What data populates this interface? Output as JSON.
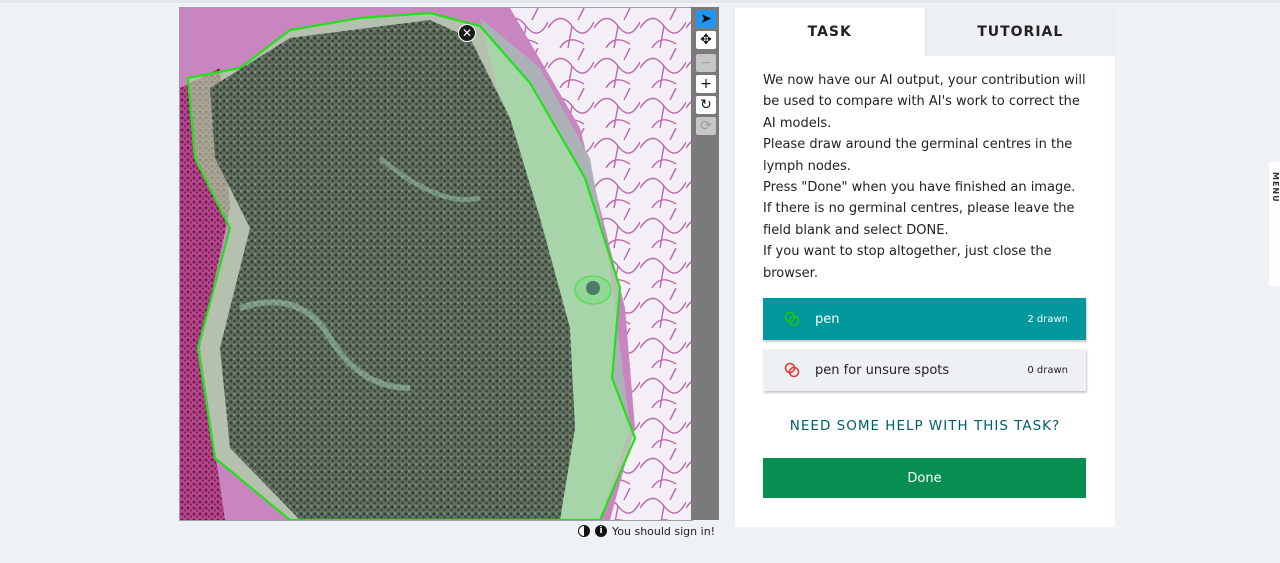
{
  "viewer": {
    "tools": [
      {
        "name": "select-pointer-icon",
        "glyph": "➤",
        "state": "active"
      },
      {
        "name": "pan-move-icon",
        "glyph": "✥",
        "state": "normal"
      },
      {
        "name": "zoom-out-icon",
        "glyph": "−",
        "state": "disabled"
      },
      {
        "name": "zoom-in-icon",
        "glyph": "+",
        "state": "normal"
      },
      {
        "name": "rotate-icon",
        "glyph": "↻",
        "state": "normal"
      },
      {
        "name": "reset-view-icon",
        "glyph": "⟳",
        "state": "disabled"
      }
    ],
    "delete_mark_glyph": "✕",
    "status_text": "You should sign in!",
    "info_glyph": "i",
    "colors": {
      "outline": "#22e01a",
      "fill": "#9fe89a",
      "tissue_dark": "#4d5a4a",
      "tissue_pink": "#c97fbf"
    }
  },
  "tabs": [
    {
      "label": "TASK",
      "active": true
    },
    {
      "label": "TUTORIAL",
      "active": false
    }
  ],
  "instructions": [
    "We now have our AI output, your contribution will be used to compare with AI's work to correct the AI models.",
    "Please draw around the germinal centres in the lymph nodes.",
    "Press \"Done\" when you have finished an image.",
    "If there is no germinal centres, please leave the field blank and select DONE.",
    "If you want to stop altogether, just close the browser."
  ],
  "drawing_tools": [
    {
      "label": "pen",
      "count": "2 drawn",
      "color": "#22c21a",
      "selected": true
    },
    {
      "label": "pen for unsure spots",
      "count": "0 drawn",
      "color": "#e53935",
      "selected": false
    }
  ],
  "help_link": "NEED SOME HELP WITH THIS TASK?",
  "done_label": "Done",
  "side_tab_label": "MENU"
}
